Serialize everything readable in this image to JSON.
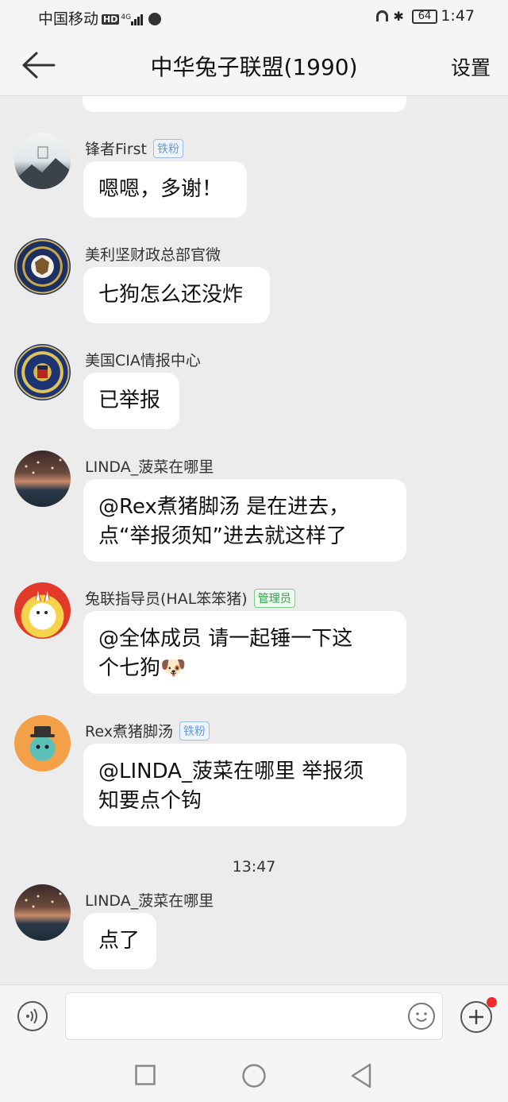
{
  "status_bar": {
    "carrier": "中国移动",
    "hd": "HD",
    "network": "4G",
    "battery": "64",
    "time": "1:47"
  },
  "header": {
    "title": "中华兔子联盟(1990)",
    "settings_label": "设置"
  },
  "messages": [
    {
      "name": "锋者First",
      "badge": "铁粉",
      "text": "嗯嗯，多谢！"
    },
    {
      "name": "美利坚财政总部官微",
      "badge": "",
      "text": "七狗怎么还没炸"
    },
    {
      "name": "美国CIA情报中心",
      "badge": "",
      "text": "已举报"
    },
    {
      "name": "LINDA_菠菜在哪里",
      "badge": "",
      "lines": [
        "@Rex煮猪脚汤 是在进去，",
        "点“举报须知”进去就这样了"
      ]
    },
    {
      "name": "兔联指导员(HAL笨笨猪)",
      "badge": "管理员",
      "lines": [
        "@全体成员 请一起锤一下这",
        "个七狗🐶"
      ]
    },
    {
      "name": "Rex煮猪脚汤",
      "badge": "铁粉",
      "lines": [
        "@LINDA_菠菜在哪里 举报须",
        "知要点个钩"
      ]
    },
    {
      "name": "LINDA_菠菜在哪里",
      "badge": "",
      "text": "点了"
    }
  ],
  "timestamp": "13:47",
  "colors": {
    "background": "#ececec",
    "bubble": "#ffffff",
    "fan_badge": "#6a9ad8",
    "admin_badge": "#2fa046",
    "notification_dot": "#f02b2b"
  },
  "icons": {
    "back": "arrow-left-icon",
    "voice": "voice-icon",
    "emoji": "emoji-icon",
    "plus": "plus-icon",
    "nav_recent": "square-icon",
    "nav_home": "circle-icon",
    "nav_back": "triangle-back-icon"
  }
}
